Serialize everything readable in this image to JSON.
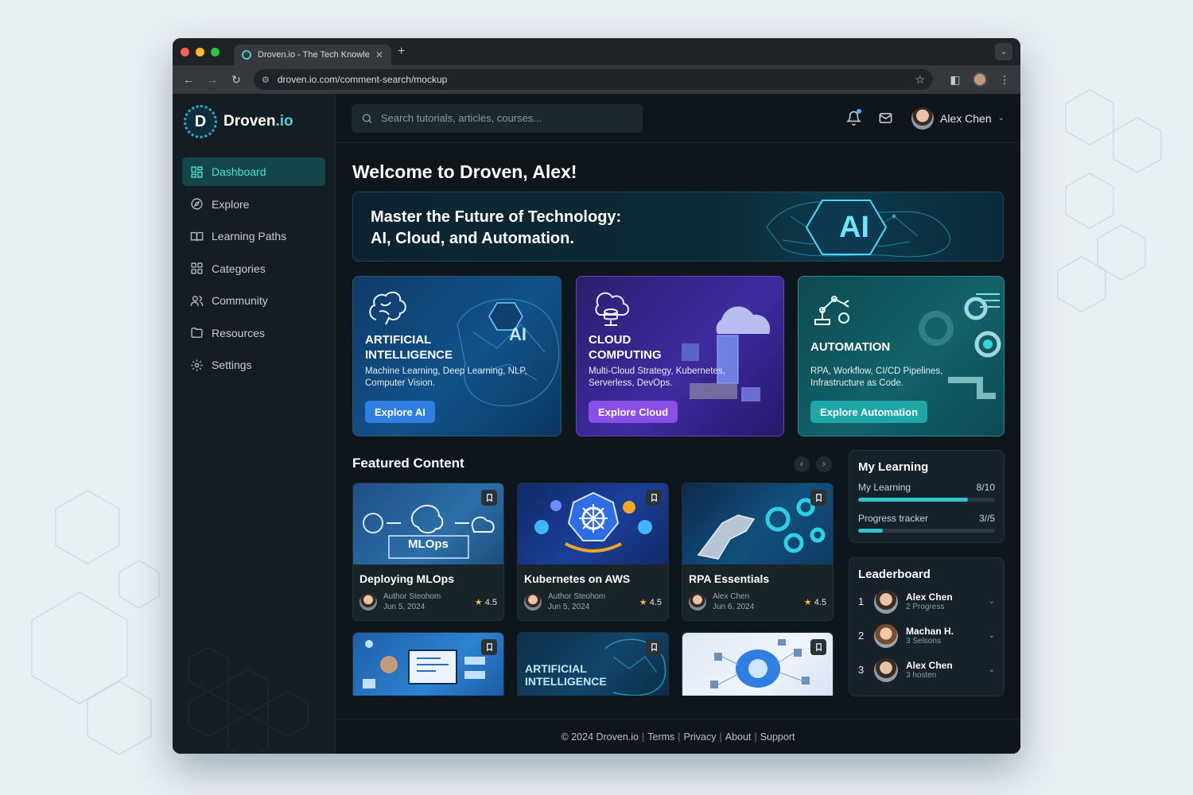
{
  "browser": {
    "tab_title": "Droven.io - The Tech Knowled",
    "url": "droven.io.com/comment-search/mockup"
  },
  "brand": {
    "name_main": "Droven",
    "name_suffix": ".io",
    "logo_letter": "D",
    "accent": "#4fd0d9"
  },
  "sidebar": {
    "items": [
      {
        "label": "Dashboard",
        "icon": "dashboard-icon",
        "active": true
      },
      {
        "label": "Explore",
        "icon": "compass-icon"
      },
      {
        "label": "Learning Paths",
        "icon": "book-icon"
      },
      {
        "label": "Categories",
        "icon": "grid-icon"
      },
      {
        "label": "Community",
        "icon": "users-icon"
      },
      {
        "label": "Resources",
        "icon": "folder-icon"
      },
      {
        "label": "Settings",
        "icon": "gear-icon"
      }
    ]
  },
  "topbar": {
    "search_placeholder": "Search tutorials, articles, courses...",
    "user_name": "Alex Chen"
  },
  "welcome": "Welcome to Droven, Alex!",
  "hero": {
    "line1": "Master the Future of Technology:",
    "line2": "AI, Cloud, and Automation.",
    "badge": "AI"
  },
  "categories": [
    {
      "title_l1": "ARTIFICIAL",
      "title_l2": "INTELLIGENCE",
      "desc": "Machine Learning, Deep Learning, NLP, Computer Vision.",
      "button": "Explore AI",
      "badge": "AI",
      "color": "#2f7fe0"
    },
    {
      "title_l1": "CLOUD",
      "title_l2": "COMPUTING",
      "desc": "Multi-Cloud Strategy, Kubernetes, Serverless, DevOps.",
      "button": "Explore Cloud",
      "color": "#8a4fe6"
    },
    {
      "title_l1": "AUTOMATION",
      "title_l2": "",
      "desc": "RPA, Workflow, CI/CD Pipelines, Infrastructure as Code.",
      "button": "Explore Automation",
      "color": "#1fa6a6"
    }
  ],
  "featured": {
    "title": "Featured Content",
    "cards": [
      {
        "title": "Deploying MLOps",
        "thumb_label": "MLOps",
        "author": "Author Steohom",
        "date": "Jun 5, 2024",
        "rating": "4.5"
      },
      {
        "title": "Kubernetes on AWS",
        "author": "Author Steohom",
        "date": "Jun 5, 2024",
        "rating": "4.5"
      },
      {
        "title": "RPA Essentials",
        "author": "Alex Chen",
        "date": "Jun 6, 2024",
        "rating": "4.5"
      },
      {
        "title": "",
        "thumb_label_l1": "ARTIFICIAL",
        "thumb_label_l2": "INTELLIGENCE"
      }
    ]
  },
  "my_learning": {
    "title": "My Learning",
    "rows": [
      {
        "label": "My Learning",
        "value": "8/10",
        "progress": 0.8
      },
      {
        "label": "Progress tracker",
        "value": "3//5",
        "progress": 0.18
      }
    ]
  },
  "leaderboard": {
    "title": "Leaderboard",
    "rows": [
      {
        "rank": "1",
        "name": "Alex Chen",
        "sub": "2 Progress"
      },
      {
        "rank": "2",
        "name": "Machan H.",
        "sub": "3 Selsons"
      },
      {
        "rank": "3",
        "name": "Alex Chen",
        "sub": "3 hosten"
      }
    ]
  },
  "footer": {
    "copyright": "© 2024 Droven.io",
    "links": [
      "Terms",
      "Privacy",
      "About",
      "Support"
    ]
  }
}
